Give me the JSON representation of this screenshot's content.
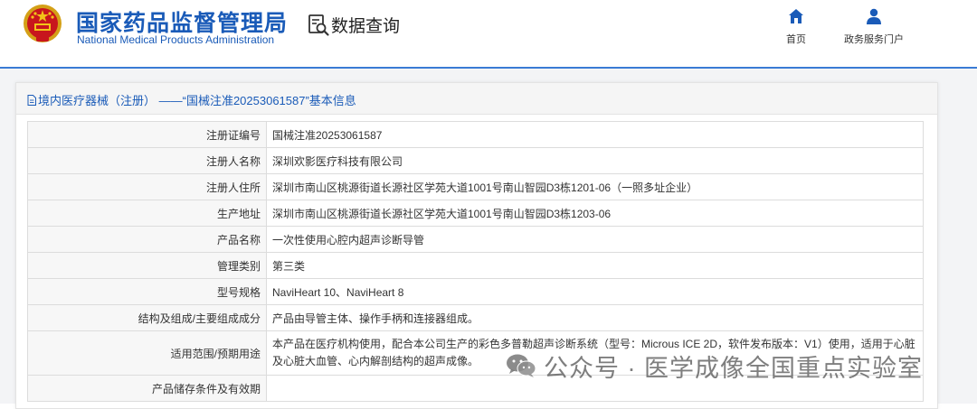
{
  "header": {
    "org_name_cn": "国家药品监督管理局",
    "org_name_en": "National Medical Products Administration",
    "section_label": "数据查询",
    "nav": [
      {
        "label": "首页",
        "icon": "home-icon"
      },
      {
        "label": "政务服务门户",
        "icon": "user-icon"
      }
    ]
  },
  "colors": {
    "brand_blue": "#1a5bb8",
    "header_line": "#3a7bd5",
    "page_background": "#f3f4f6",
    "label_background": "#f7f7f7"
  },
  "panel": {
    "title": "境内医疗器械（注册） ——“国械注准20253061587”基本信息"
  },
  "table": {
    "rows": [
      {
        "label": "注册证编号",
        "value": "国械注准20253061587"
      },
      {
        "label": "注册人名称",
        "value": "深圳欢影医疗科技有限公司"
      },
      {
        "label": "注册人住所",
        "value": "深圳市南山区桃源街道长源社区学苑大道1001号南山智园D3栋1201-06（一照多址企业）"
      },
      {
        "label": "生产地址",
        "value": "深圳市南山区桃源街道长源社区学苑大道1001号南山智园D3栋1203-06"
      },
      {
        "label": "产品名称",
        "value": "一次性使用心腔内超声诊断导管"
      },
      {
        "label": "管理类别",
        "value": "第三类"
      },
      {
        "label": "型号规格",
        "value": "NaviHeart 10、NaviHeart 8"
      },
      {
        "label": "结构及组成/主要组成成分",
        "value": "产品由导管主体、操作手柄和连接器组成。"
      },
      {
        "label": "适用范围/预期用途",
        "value": "本产品在医疗机构使用，配合本公司生产的彩色多普勒超声诊断系统（型号：Microus ICE 2D，软件发布版本：V1）使用，适用于心脏及心脏大血管、心内解剖结构的超声成像。"
      },
      {
        "label": "产品储存条件及有效期",
        "value": ""
      }
    ]
  },
  "watermark": {
    "icon": "wechat-icon",
    "text": "公众号 · 医学成像全国重点实验室"
  }
}
